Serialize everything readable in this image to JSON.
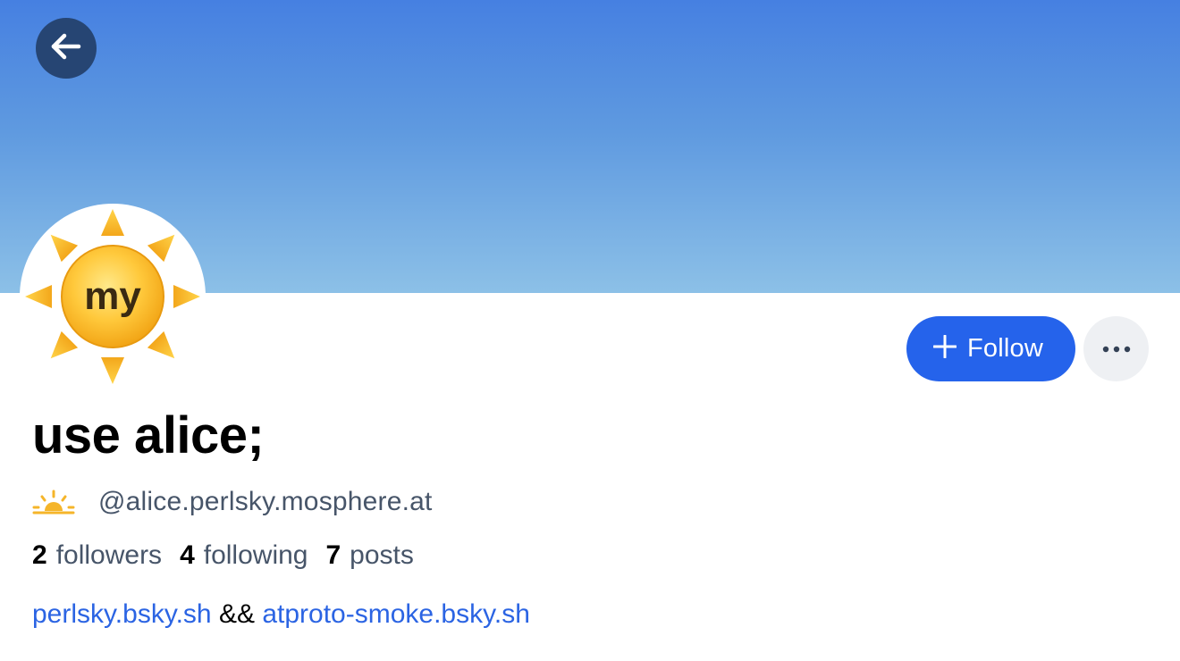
{
  "profile": {
    "display_name": "use alice;",
    "handle": "@alice.perlsky.mosphere.at",
    "avatar_text": "my",
    "status_emoji": "sunrise-icon"
  },
  "actions": {
    "follow_label": "Follow",
    "back_icon": "arrow-left-icon",
    "more_icon": "ellipsis-icon"
  },
  "stats": [
    {
      "count": "2",
      "label": "followers"
    },
    {
      "count": "4",
      "label": "following"
    },
    {
      "count": "7",
      "label": "posts"
    }
  ],
  "bio": {
    "link_1": "perlsky.bsky.sh",
    "separator": " && ",
    "link_2": "atproto-smoke.bsky.sh"
  },
  "colors": {
    "banner_top": "#4680e1",
    "banner_bottom": "#8cc0e7",
    "follow_button": "#2563eb",
    "link": "#2b64e3",
    "back_button": "#264573",
    "muted_text": "#475569"
  }
}
